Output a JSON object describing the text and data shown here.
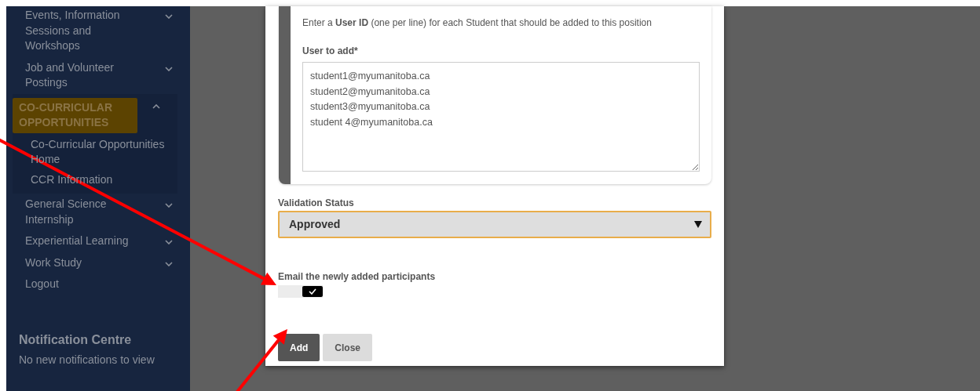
{
  "sidebar": {
    "items": [
      {
        "label": "Events, Information Sessions and Workshops",
        "kind": "group",
        "expanded": false,
        "selected": false
      },
      {
        "label": "Job and Volunteer Postings",
        "kind": "group",
        "expanded": false,
        "selected": false
      },
      {
        "label": "CO-CURRICULAR OPPORTUNITIES",
        "kind": "group",
        "expanded": true,
        "selected": true,
        "children": [
          {
            "label": "Co-Curricular Opportunities Home"
          },
          {
            "label": "CCR Information"
          }
        ]
      },
      {
        "label": "General Science Internship",
        "kind": "group",
        "expanded": false,
        "selected": false
      },
      {
        "label": "Experiential Learning",
        "kind": "group",
        "expanded": false,
        "selected": false
      },
      {
        "label": "Work Study",
        "kind": "group",
        "expanded": false,
        "selected": false
      },
      {
        "label": "Logout",
        "kind": "link"
      }
    ]
  },
  "notification_centre": {
    "title": "Notification Centre",
    "message": "No new notifications to view"
  },
  "modal": {
    "instructions": "Enter a **User ID** (one per line) for each Student that should be added to this position",
    "user_field": {
      "label": "User to add*",
      "value": "student1@myumanitoba.ca\nstudent2@myumanitoba.ca\nstudent3@myumanitoba.ca\nstudent 4@myumanitoba.ca"
    },
    "validation_status": {
      "label": "Validation Status",
      "value": "Approved"
    },
    "email_toggle": {
      "label": "Email the newly added participants",
      "on": true
    },
    "buttons": [
      {
        "label": "Add",
        "kind": "primary"
      },
      {
        "label": "Close",
        "kind": "secondary"
      }
    ]
  }
}
